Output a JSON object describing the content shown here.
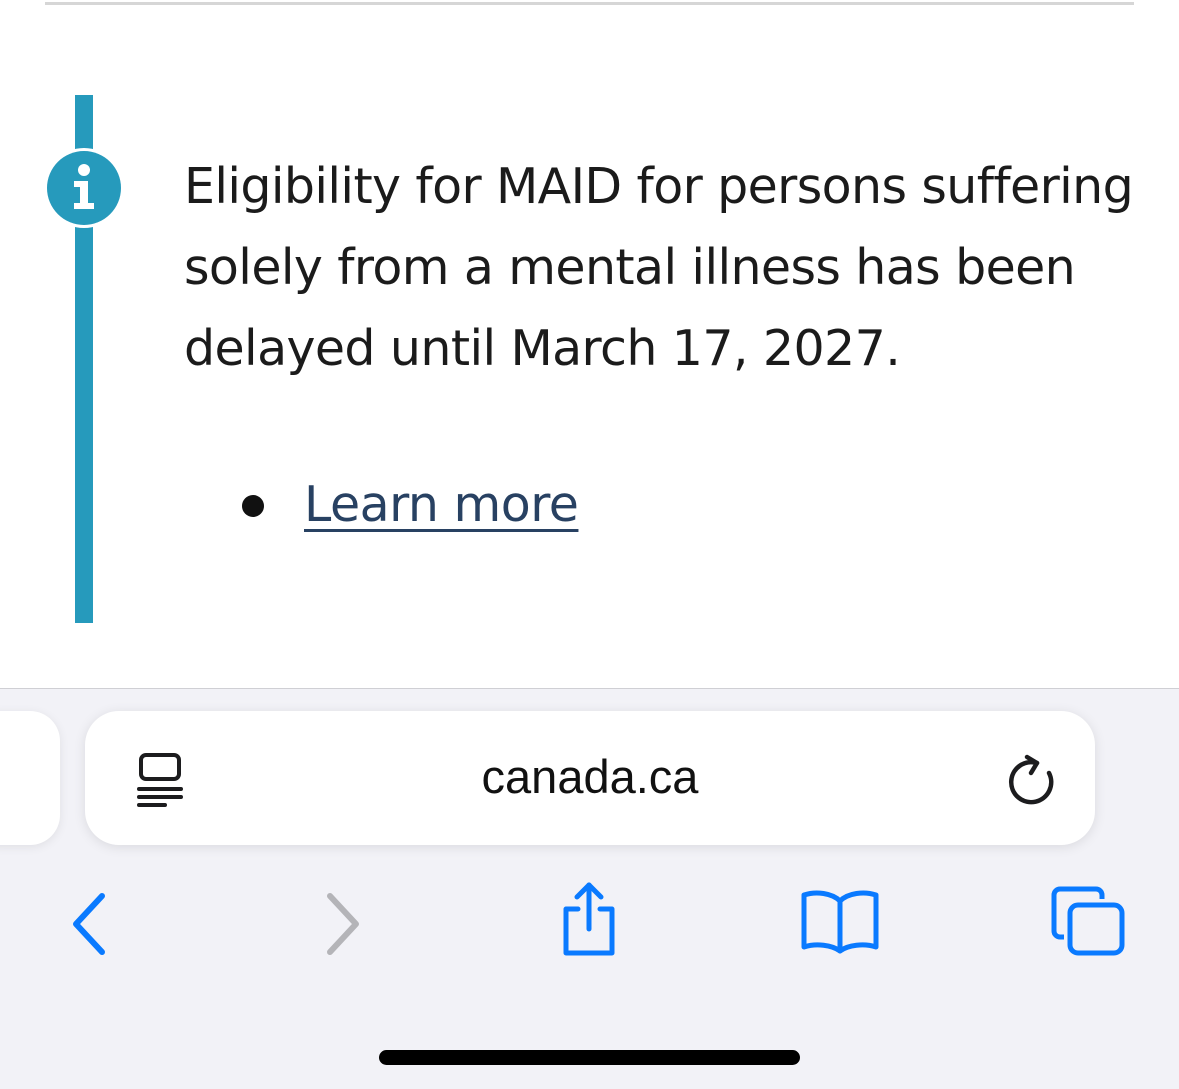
{
  "alert": {
    "type": "info",
    "message": "Eligibility for MAID for persons suffering solely from a mental illness has been delayed until March 17, 2027.",
    "links": [
      {
        "label": "Learn more"
      }
    ]
  },
  "browser": {
    "url": "canada.ca",
    "icons": {
      "reader": "reader-mode-icon",
      "reload": "reload-icon",
      "back": "chevron-left-icon",
      "forward": "chevron-right-icon",
      "share": "share-icon",
      "bookmarks": "book-icon",
      "tabs": "tabs-icon"
    }
  },
  "colors": {
    "alert_accent": "#269abc",
    "link": "#284162",
    "ios_blue": "#0a7aff",
    "disabled": "#b4b4b8",
    "toolbar_bg": "#f2f2f7"
  }
}
